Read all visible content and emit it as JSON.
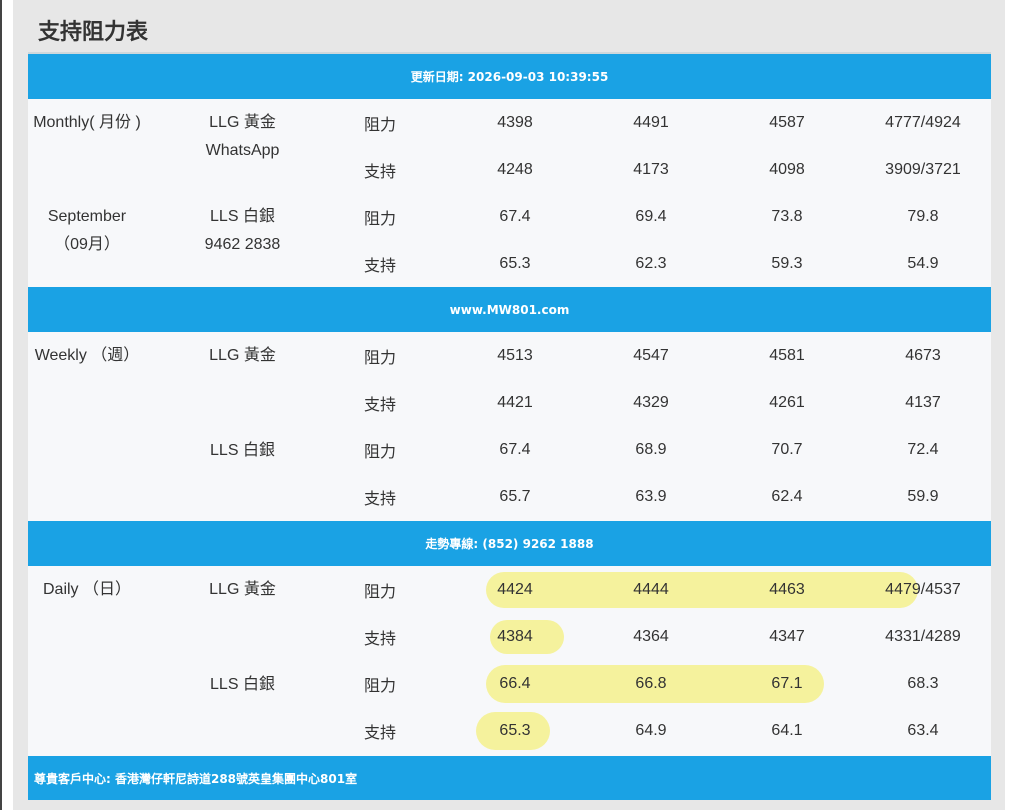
{
  "page_title": "支持阻力表",
  "bands": {
    "update": "更新日期: 2026-09-03 10:39:55",
    "website": "www.MW801.com",
    "hotline": "走勢專線: (852) 9262 1888",
    "address": "尊貴客戶中心: 香港灣仔軒尼詩道288號英皇集團中心801室"
  },
  "monthly": {
    "period_1": "Monthly( 月份 )",
    "period_2": "September",
    "period_3": "（09月）",
    "gold": "LLG 黃金",
    "whatsapp": "WhatsApp",
    "silver": "LLS 白銀",
    "phone": "9462 2838",
    "rows": [
      {
        "type": "阻力",
        "values": [
          "4398",
          "4491",
          "4587",
          "4777/4924"
        ]
      },
      {
        "type": "支持",
        "values": [
          "4248",
          "4173",
          "4098",
          "3909/3721"
        ]
      },
      {
        "type": "阻力",
        "values": [
          "67.4",
          "69.4",
          "73.8",
          "79.8"
        ]
      },
      {
        "type": "支持",
        "values": [
          "65.3",
          "62.3",
          "59.3",
          "54.9"
        ]
      }
    ]
  },
  "weekly": {
    "period": "Weekly （週）",
    "gold": "LLG 黃金",
    "silver": "LLS 白銀",
    "rows": [
      {
        "type": "阻力",
        "values": [
          "4513",
          "4547",
          "4581",
          "4673"
        ]
      },
      {
        "type": "支持",
        "values": [
          "4421",
          "4329",
          "4261",
          "4137"
        ]
      },
      {
        "type": "阻力",
        "values": [
          "67.4",
          "68.9",
          "70.7",
          "72.4"
        ]
      },
      {
        "type": "支持",
        "values": [
          "65.7",
          "63.9",
          "62.4",
          "59.9"
        ]
      }
    ]
  },
  "daily": {
    "period": "Daily （日）",
    "gold": "LLG 黃金",
    "silver": "LLS 白銀",
    "rows": [
      {
        "type": "阻力",
        "values": [
          "4424",
          "4444",
          "4463",
          "4479/4537"
        ]
      },
      {
        "type": "支持",
        "values": [
          "4384",
          "4364",
          "4347",
          "4331/4289"
        ]
      },
      {
        "type": "阻力",
        "values": [
          "66.4",
          "66.8",
          "67.1",
          "68.3"
        ]
      },
      {
        "type": "支持",
        "values": [
          "65.3",
          "64.9",
          "64.1",
          "63.4"
        ]
      }
    ]
  },
  "colors": {
    "band": "#1aa2e4",
    "highlight": "#f4f078",
    "panel": "#e7e7e7",
    "section": "#f7f8fa"
  }
}
